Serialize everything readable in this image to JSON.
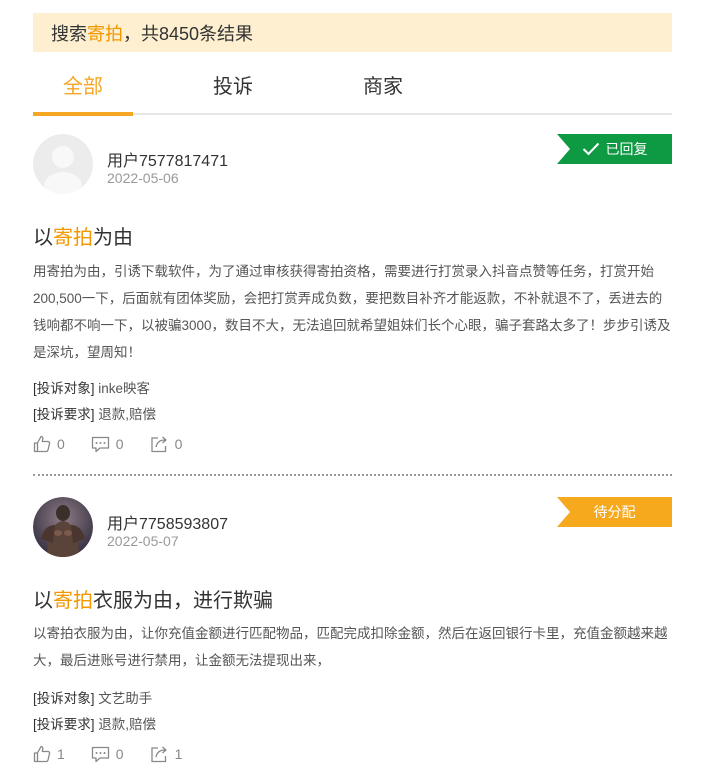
{
  "search": {
    "prefix": "搜索 ",
    "keyword": "寄拍",
    "suffix": "，共8450条结果"
  },
  "tabs": [
    "全部",
    "投诉",
    "商家"
  ],
  "colors": {
    "accent": "#f5a623",
    "replied": "#0e9a43",
    "pending": "#f7a91d"
  },
  "posts": [
    {
      "user": "用户7577817471",
      "date": "2022-05-06",
      "status": "已回复",
      "title_pre": "以",
      "title_kw": "寄拍",
      "title_post": "为由",
      "body": "用寄拍为由，引诱下载软件，为了通过审核获得寄拍资格，需要进行打赏录入抖音点赞等任务，打赏开始200,500一下，后面就有团体奖励，会把打赏弄成负数，要把数目补齐才能返款，不补就退不了，丢进去的钱响都不响一下，以被骗3000，数目不大，无法追回就希望姐妹们长个心眼，骗子套路太多了！步步引诱及是深坑，望周知！",
      "target_label": "[投诉对象]",
      "target": " inke映客",
      "demand_label": "[投诉要求]",
      "demand": " 退款,赔偿",
      "likes": "0",
      "comments": "0",
      "shares": "0"
    },
    {
      "user": "用户7758593807",
      "date": "2022-05-07",
      "status": "待分配",
      "title_pre": "以",
      "title_kw": "寄拍",
      "title_post": "衣服为由，进行欺骗",
      "body": "以寄拍衣服为由，让你充值金额进行匹配物品，匹配完成扣除金额，然后在返回银行卡里，充值金额越来越大，最后进账号进行禁用，让金额无法提现出来，",
      "target_label": "[投诉对象]",
      "target": " 文艺助手",
      "demand_label": "[投诉要求]",
      "demand": " 退款,赔偿",
      "likes": "1",
      "comments": "0",
      "shares": "1"
    }
  ]
}
